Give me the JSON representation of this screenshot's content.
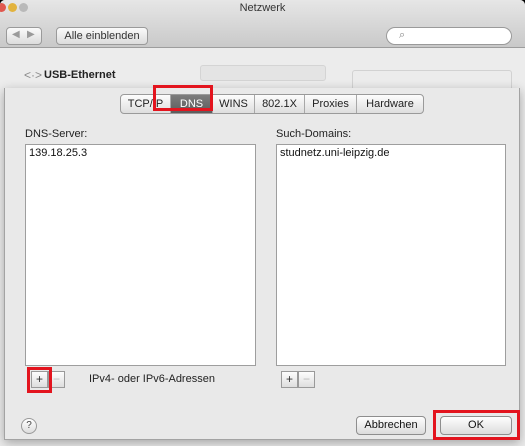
{
  "window": {
    "title": "Netzwerk"
  },
  "toolbar": {
    "back_icon": "chevron-left",
    "forward_icon": "chevron-right",
    "show_all_label": "Alle einblenden",
    "search_icon": "magnifier",
    "search_value": ""
  },
  "interface": {
    "nav_icon": "back-forward-arrows",
    "title": "USB-Ethernet"
  },
  "tabs": [
    {
      "label": "TCP/IP",
      "selected": false
    },
    {
      "label": "DNS",
      "selected": true
    },
    {
      "label": "WINS",
      "selected": false
    },
    {
      "label": "802.1X",
      "selected": false
    },
    {
      "label": "Proxies",
      "selected": false
    },
    {
      "label": "Hardware",
      "selected": false
    }
  ],
  "dns_servers": {
    "label": "DNS-Server:",
    "entries": [
      "139.18.25.3"
    ],
    "add_label": "+",
    "remove_label": "−",
    "hint": "IPv4- oder IPv6-Adressen"
  },
  "search_domains": {
    "label": "Such-Domains:",
    "entries": [
      "studnetz.uni-leipzig.de"
    ],
    "add_label": "+",
    "remove_label": "−"
  },
  "footer": {
    "help_label": "?",
    "cancel_label": "Abbrechen",
    "ok_label": "OK"
  },
  "colors": {
    "highlight": "#e3141e",
    "selected_tab": "#6a6a6a"
  }
}
